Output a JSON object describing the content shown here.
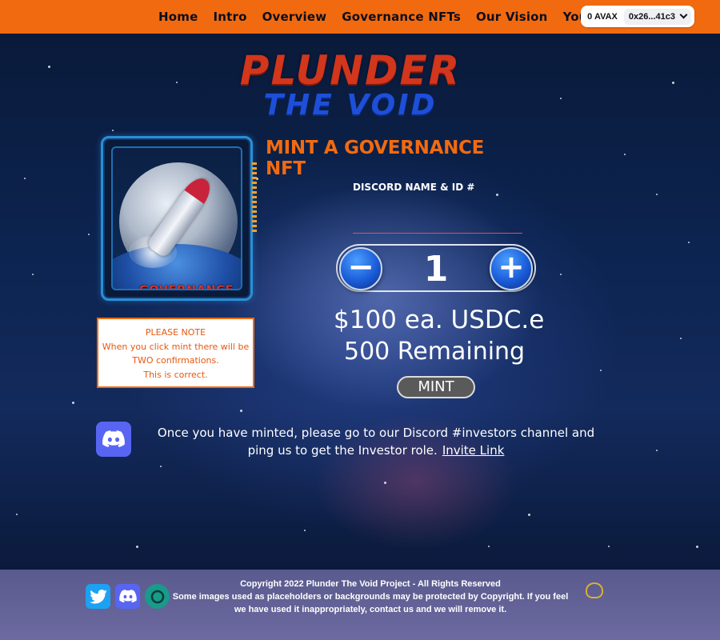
{
  "nav": {
    "items": [
      "Home",
      "Intro",
      "Overview",
      "Governance NFTs",
      "Our Vision",
      "Your Help"
    ]
  },
  "wallet": {
    "balance": "0 AVAX",
    "address": "0x26...41c3"
  },
  "logo": {
    "line1": "PLUNDER",
    "line2": "THE VOID"
  },
  "card": {
    "label": "GOVERNANCE"
  },
  "note": {
    "line1": "PLEASE NOTE",
    "line2": "When you click mint there will be",
    "line3": "TWO confirmations.",
    "line4": "This is correct."
  },
  "mint": {
    "title": "MINT A GOVERNANCE NFT",
    "discord_label": "DISCORD NAME & ID #",
    "discord_value": "",
    "quantity": "1",
    "minus": "−",
    "plus": "+",
    "price": "$100 ea. USDC.e",
    "remaining": "500 Remaining",
    "button": "MINT"
  },
  "discord_message": {
    "text": "Once you have minted, please go to our Discord #investors channel and ping us to get the Investor role.",
    "link": "Invite Link"
  },
  "footer": {
    "copyright": "Copyright 2022 Plunder The Void Project - All Rights Reserved",
    "disclaimer": "Some images used as placeholders or backgrounds may be protected by Copyright. If you feel we have used it inappropriately, contact us and we will remove it."
  },
  "colors": {
    "header": "#f26a0f",
    "accent": "#f26a0f",
    "footer": "#6462a0",
    "discord": "#5865f2",
    "twitter": "#1da1f2"
  },
  "icons": [
    "discord-icon",
    "twitter-icon",
    "coinmarketcap-icon",
    "chevron-down-icon"
  ]
}
